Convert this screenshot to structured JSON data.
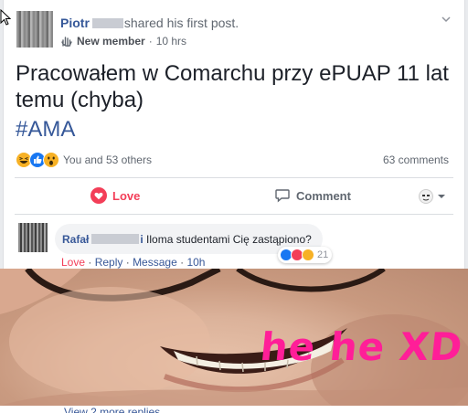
{
  "post": {
    "author_name": "Piotr",
    "author_action": "shared his first post.",
    "badge": "New member",
    "time": "10 hrs",
    "text": "Pracowałem w Comarchu przy ePUAP 11 lat temu (chyba)",
    "hashtag": "#AMA",
    "reactions_text": "You and 53 others",
    "comments_count": "63 comments"
  },
  "actions": {
    "love_label": "Love",
    "comment_label": "Comment"
  },
  "comment": {
    "author": "Rafał",
    "author_suffix": "i",
    "text": "Iloma studentami Cię zastąpiono?",
    "reaction_count": "21",
    "love_link": "Love",
    "reply_link": "Reply",
    "message_link": "Message",
    "time": "10h",
    "separator": " · "
  },
  "meme": {
    "caption": "he he XD"
  },
  "view_more": "View 2 more replies",
  "colors": {
    "link_blue": "#365899",
    "love_red": "#f33e58",
    "meme_pink": "#ff1e98",
    "like_blue": "#1877f2",
    "haha_yellow": "#f7b125"
  },
  "icons": [
    "cursor-icon",
    "chevron-down-icon",
    "new-member-icon",
    "haha-icon",
    "like-icon",
    "wow-icon",
    "love-icon",
    "comment-icon",
    "profile-mini-icon",
    "caret-down-icon"
  ]
}
